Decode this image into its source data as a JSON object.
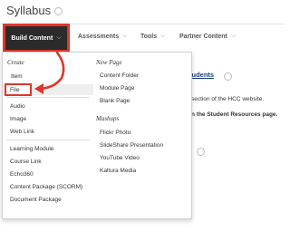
{
  "page": {
    "title": "Syllabus"
  },
  "toolbar": {
    "build_content": "Build Content",
    "assessments": "Assessments",
    "tools": "Tools",
    "partner_content": "Partner Content"
  },
  "background": {
    "link_fragment": "tudents",
    "line1": "section of the HCC website.",
    "line2": "n the Student Resources page."
  },
  "menu": {
    "create_heading": "Create",
    "new_page_heading": "New Page",
    "mashups_heading": "Mashups",
    "create_items": [
      "Item",
      "File",
      "Audio",
      "Image",
      "Web Link",
      "Learning Module",
      "Course Link",
      "Echo360",
      "Content Package (SCORM)",
      "Document Package"
    ],
    "new_page_items": [
      "Content Folder",
      "Module Page",
      "Blank Page"
    ],
    "mashup_items": [
      "Flickr Photo",
      "SlideShare Presentation",
      "YouTube Video",
      "Kaltura Media"
    ]
  },
  "colors": {
    "highlight": "#e0362a",
    "button_bg": "#2b2b2b"
  }
}
